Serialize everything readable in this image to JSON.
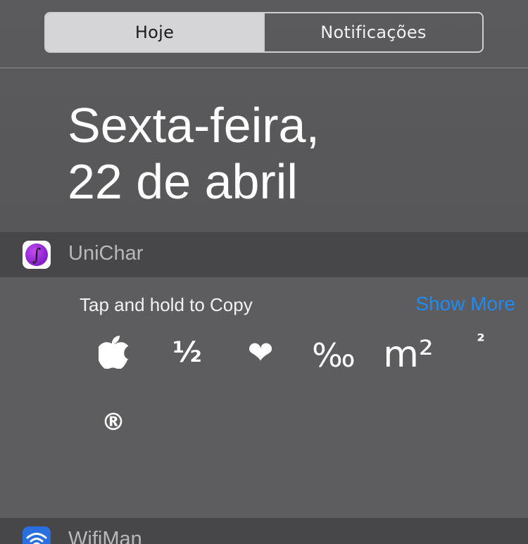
{
  "tabs": {
    "today": "Hoje",
    "notifications": "Notificações"
  },
  "date": {
    "line1": "Sexta-feira,",
    "line2": "22 de abril"
  },
  "widget_unichar": {
    "name": "UniChar",
    "icon": "integral-sign-icon",
    "instruction": "Tap and hold to Copy",
    "show_more": "Show More",
    "characters": [
      "",
      "½",
      "❤",
      "‰",
      "m²",
      "²",
      "®"
    ]
  },
  "widget_wifiman": {
    "name": "WifiMan",
    "icon": "wifi-icon"
  },
  "colors": {
    "accent_blue": "#1e8bf3",
    "segment_active": "#d5d5d7",
    "header_bg": "#474749",
    "body_bg": "#5d5d5f"
  }
}
